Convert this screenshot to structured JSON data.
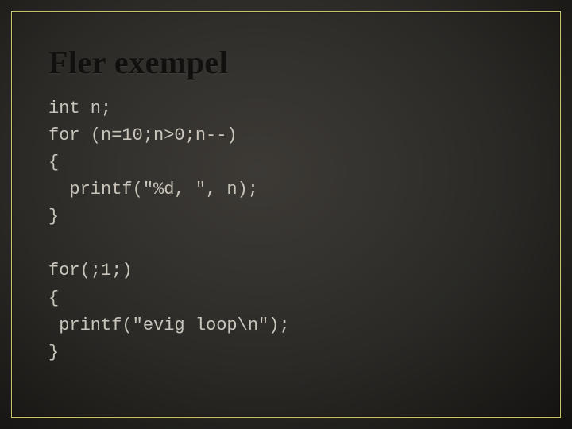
{
  "slide": {
    "title": "Fler exempel",
    "code_block_1": "int n;\nfor (n=10;n>0;n--)\n{\n  printf(\"%d, \", n);\n}",
    "code_block_2": "for(;1;)\n{\n printf(\"evig loop\\n\");\n}"
  }
}
